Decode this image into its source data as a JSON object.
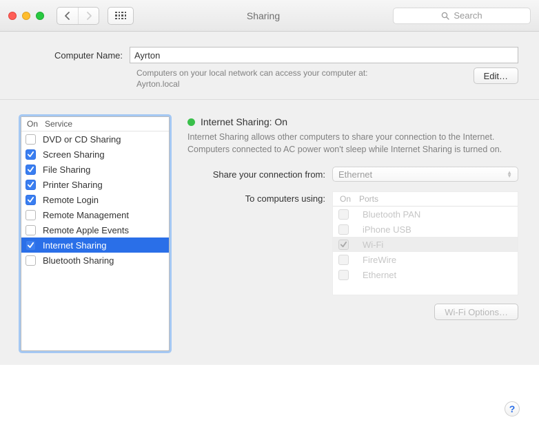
{
  "window": {
    "title": "Sharing",
    "search_placeholder": "Search"
  },
  "header": {
    "computer_name_label": "Computer Name:",
    "computer_name_value": "Ayrton",
    "hint_line1": "Computers on your local network can access your computer at:",
    "hint_line2": "Ayrton.local",
    "edit_label": "Edit…"
  },
  "services": {
    "col_on": "On",
    "col_service": "Service",
    "items": [
      {
        "on": false,
        "label": "DVD or CD Sharing",
        "selected": false
      },
      {
        "on": true,
        "label": "Screen Sharing",
        "selected": false
      },
      {
        "on": true,
        "label": "File Sharing",
        "selected": false
      },
      {
        "on": true,
        "label": "Printer Sharing",
        "selected": false
      },
      {
        "on": true,
        "label": "Remote Login",
        "selected": false
      },
      {
        "on": false,
        "label": "Remote Management",
        "selected": false
      },
      {
        "on": false,
        "label": "Remote Apple Events",
        "selected": false
      },
      {
        "on": true,
        "label": "Internet Sharing",
        "selected": true
      },
      {
        "on": false,
        "label": "Bluetooth Sharing",
        "selected": false
      }
    ]
  },
  "detail": {
    "status_title": "Internet Sharing: On",
    "status_color": "#3ac04b",
    "description": "Internet Sharing allows other computers to share your connection to the Internet. Computers connected to AC power won't sleep while Internet Sharing is turned on.",
    "share_from_label": "Share your connection from:",
    "share_from_value": "Ethernet",
    "to_using_label": "To computers using:",
    "ports_col_on": "On",
    "ports_col_ports": "Ports",
    "ports": [
      {
        "on": false,
        "label": "Bluetooth PAN",
        "selected": false
      },
      {
        "on": false,
        "label": "iPhone USB",
        "selected": false
      },
      {
        "on": true,
        "label": "Wi-Fi",
        "selected": true
      },
      {
        "on": false,
        "label": "FireWire",
        "selected": false
      },
      {
        "on": false,
        "label": "Ethernet",
        "selected": false
      }
    ],
    "wifi_options_label": "Wi-Fi Options…"
  },
  "help_label": "?"
}
